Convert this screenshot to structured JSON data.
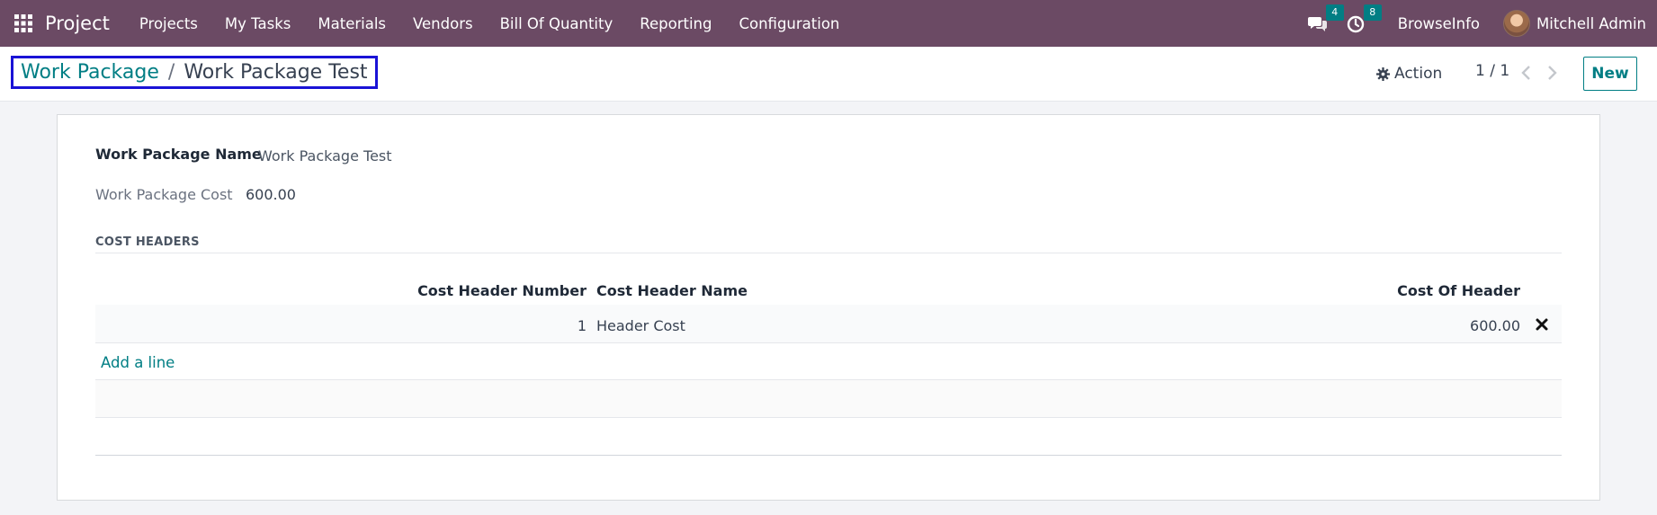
{
  "navbar": {
    "brand": "Project",
    "menu": [
      "Projects",
      "My Tasks",
      "Materials",
      "Vendors",
      "Bill Of Quantity",
      "Reporting",
      "Configuration"
    ],
    "messages_count": "4",
    "activities_count": "8",
    "company": "BrowseInfo",
    "user": "Mitchell Admin"
  },
  "control": {
    "breadcrumb_parent": "Work Package",
    "breadcrumb_sep": "/",
    "breadcrumb_current": "Work Package Test",
    "action_label": "Action",
    "pager": "1 / 1",
    "new_label": "New"
  },
  "form": {
    "name_label": "Work Package Name",
    "name_value": "Work Package Test",
    "cost_label": "Work Package Cost",
    "cost_value": "600.00",
    "section_title": "COST HEADERS",
    "columns": {
      "number": "Cost Header Number",
      "name": "Cost Header Name",
      "cost": "Cost Of Header"
    },
    "rows": [
      {
        "number": "1",
        "name": "Header Cost",
        "cost": "600.00"
      }
    ],
    "add_line": "Add a line"
  },
  "colors": {
    "navbar_bg": "#6b4a64",
    "accent": "#017e84",
    "highlight_border": "#1a13d6"
  }
}
